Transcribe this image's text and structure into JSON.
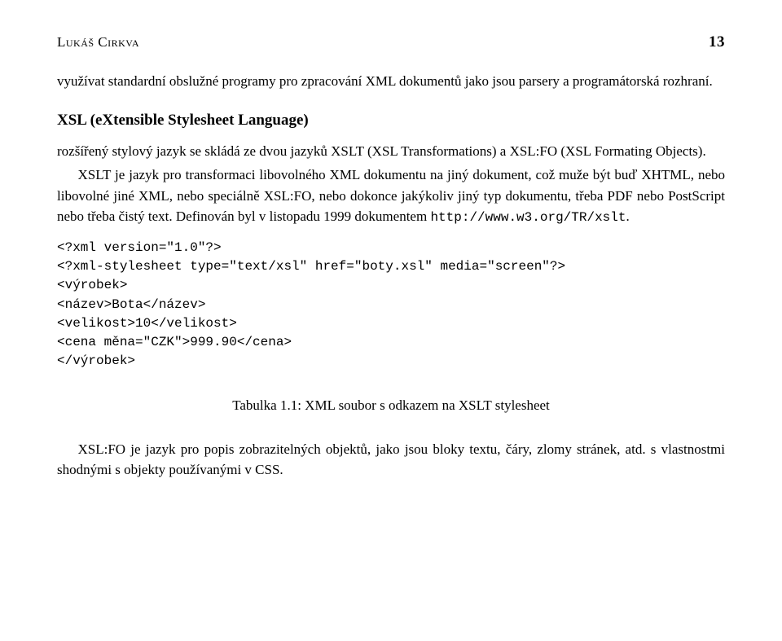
{
  "header": {
    "author": "Lukáš Cirkva",
    "page": "13"
  },
  "intro": "využívat standardní obslužné programy pro zpracování XML dokumentů jako jsou parsery a programátorská rozhraní.",
  "section_title": "XSL (eXtensible Stylesheet Language)",
  "para1": "rozšířený stylový jazyk se skládá ze dvou jazyků XSLT (XSL Transformations) a XSL:FO (XSL Formating Objects).",
  "para2a": "XSLT je jazyk pro transformaci libovolného XML dokumentu na jiný dokument, což muže být buď XHTML, nebo libovolné jiné XML, nebo speciálně XSL:FO, nebo dokonce jakýkoliv jiný typ dokumentu, třeba PDF nebo PostScript nebo třeba čistý text. Definován byl v listopadu 1999 dokumentem ",
  "para2_tt": "http://www.w3.org/TR/xslt",
  "para2b": ".",
  "code": {
    "l1": "<?xml version=\"1.0\"?>",
    "l2": "<?xml-stylesheet type=\"text/xsl\" href=\"boty.xsl\" media=\"screen\"?>",
    "l3": "<výrobek>",
    "l4": "<název>Bota</název>",
    "l5": "<velikost>10</velikost>",
    "l6": "<cena měna=\"CZK\">999.90</cena>",
    "l7": "</výrobek>"
  },
  "table_caption": "Tabulka 1.1: XML soubor s odkazem na XSLT stylesheet",
  "para3": "XSL:FO je jazyk pro popis zobrazitelných objektů, jako jsou bloky textu, čáry, zlomy stránek, atd. s vlastnostmi shodnými s objekty používanými v CSS."
}
